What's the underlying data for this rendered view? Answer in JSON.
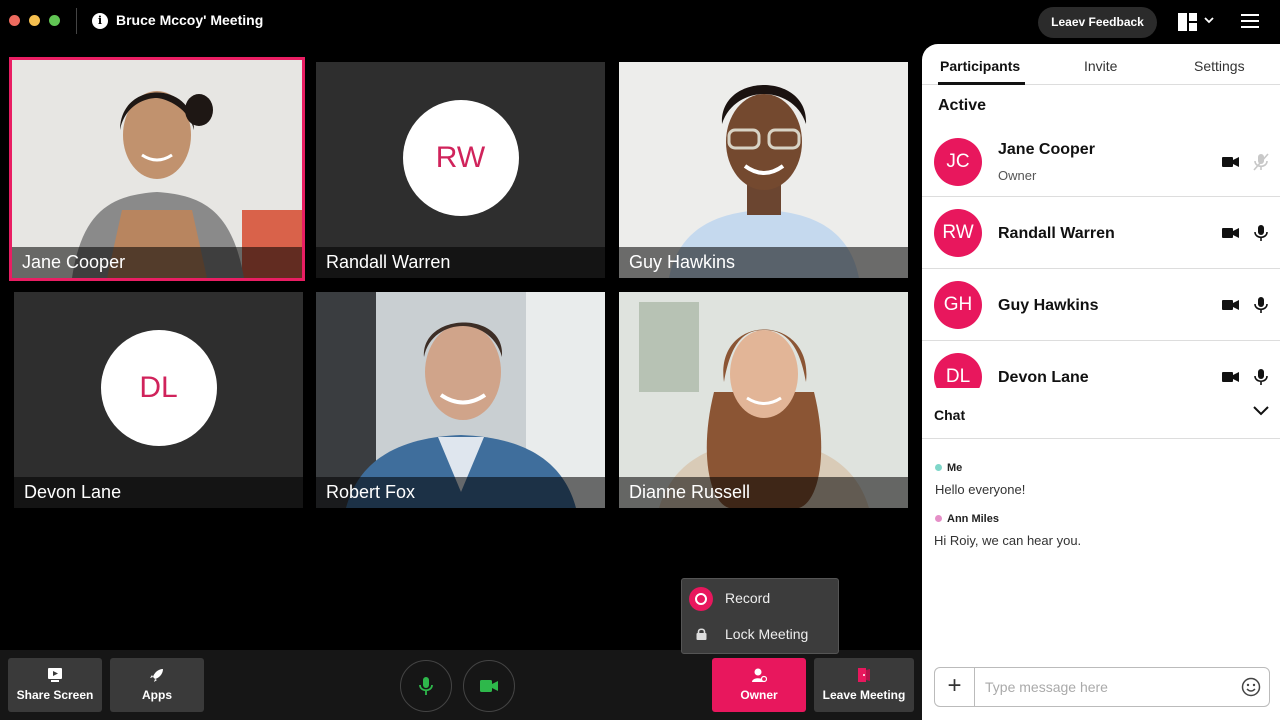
{
  "window": {
    "title": "Bruce Mccoy' Meeting",
    "feedback_label": "Leaev Feedback"
  },
  "grid": {
    "tiles": [
      {
        "name": "Jane Cooper",
        "initials": "",
        "type": "video",
        "active": true
      },
      {
        "name": "Randall Warren",
        "initials": "RW",
        "type": "avatar"
      },
      {
        "name": "Guy Hawkins",
        "initials": "",
        "type": "video"
      },
      {
        "name": "Devon Lane",
        "initials": "DL",
        "type": "avatar"
      },
      {
        "name": "Robert Fox",
        "initials": "",
        "type": "video"
      },
      {
        "name": "Dianne Russell",
        "initials": "",
        "type": "video"
      }
    ]
  },
  "panel": {
    "tabs": [
      "Participants",
      "Invite",
      "Settings"
    ],
    "active_label": "Active",
    "participants": [
      {
        "initials": "JC",
        "name": "Jane Cooper",
        "role": "Owner",
        "mic": "muted"
      },
      {
        "initials": "RW",
        "name": "Randall Warren",
        "role": "",
        "mic": "on"
      },
      {
        "initials": "GH",
        "name": "Guy Hawkins",
        "role": "",
        "mic": "on"
      },
      {
        "initials": "DL",
        "name": "Devon Lane",
        "role": "",
        "mic": "on"
      }
    ],
    "chat": {
      "label": "Chat",
      "messages": [
        {
          "author": "Me",
          "text": "Hello everyone!",
          "dot_color": "#7fd6c9"
        },
        {
          "author": "Ann Miles",
          "text": "Hi Roiy, we can hear you.",
          "dot_color": "#e58fc7"
        }
      ],
      "placeholder": "Type message here"
    }
  },
  "toolbar": {
    "share_screen": "Share Screen",
    "apps": "Apps",
    "owner": "Owner",
    "leave": "Leave Meeting"
  },
  "popup": {
    "record": "Record",
    "lock": "Lock Meeting"
  },
  "colors": {
    "accent": "#e8175d",
    "mic_green": "#2eb84b"
  }
}
